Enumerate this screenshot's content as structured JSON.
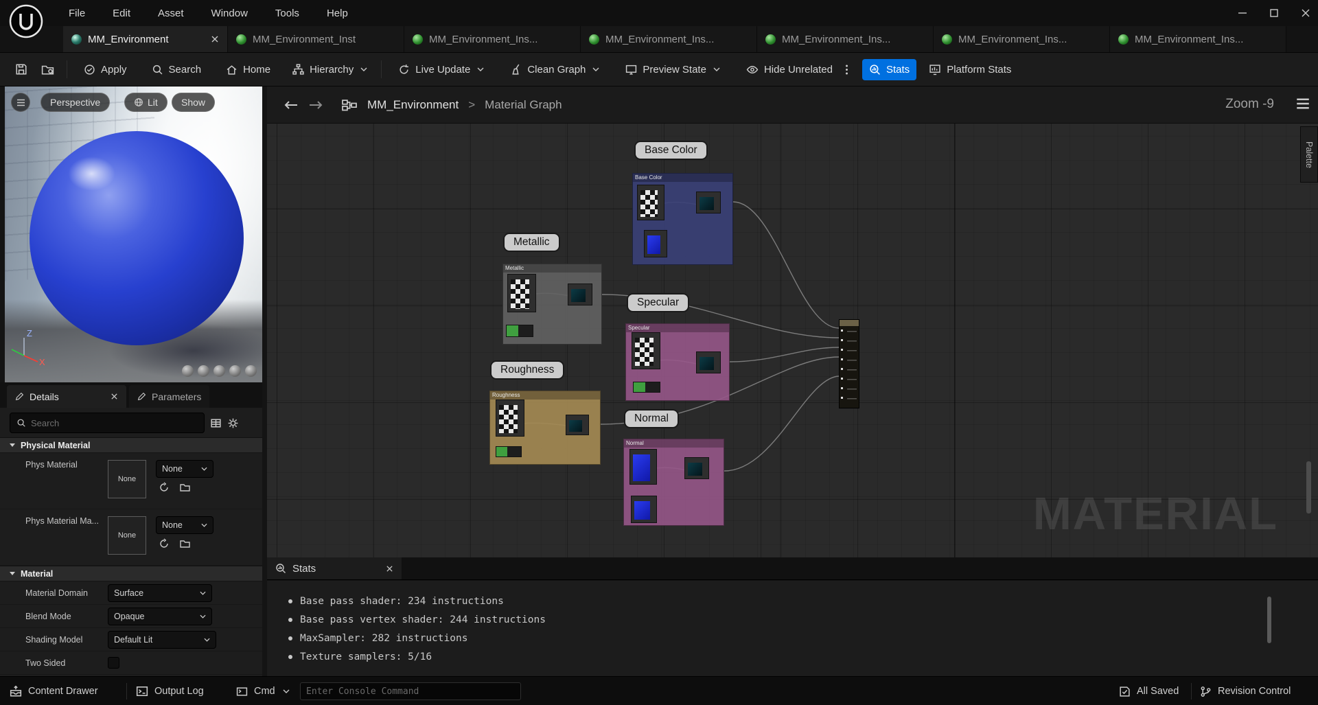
{
  "window": {
    "menu_items": [
      "File",
      "Edit",
      "Asset",
      "Window",
      "Tools",
      "Help"
    ]
  },
  "tab_bar": {
    "tabs": [
      {
        "label": "MM_Environment",
        "active": true
      },
      {
        "label": "MM_Environment_Inst",
        "active": false
      },
      {
        "label": "MM_Environment_Ins...",
        "active": false
      },
      {
        "label": "MM_Environment_Ins...",
        "active": false
      },
      {
        "label": "MM_Environment_Ins...",
        "active": false
      },
      {
        "label": "MM_Environment_Ins...",
        "active": false
      },
      {
        "label": "MM_Environment_Ins...",
        "active": false
      }
    ]
  },
  "toolbar": {
    "apply": "Apply",
    "search": "Search",
    "home": "Home",
    "hierarchy": "Hierarchy",
    "live_update": "Live Update",
    "clean_graph": "Clean Graph",
    "preview_state": "Preview State",
    "hide_unrelated": "Hide Unrelated",
    "stats": "Stats",
    "platform_stats": "Platform Stats",
    "stats_active_color": "#0070e0"
  },
  "viewport": {
    "perspective_label": "Perspective",
    "lit_label": "Lit",
    "show_label": "Show",
    "axis_z": "Z",
    "axis_x": "X",
    "sphere_color": "#2740cf"
  },
  "details_panel": {
    "tab_details": "Details",
    "tab_parameters": "Parameters",
    "search_placeholder": "Search",
    "sections": [
      {
        "title": "Physical Material",
        "rows": [
          {
            "label": "Phys Material",
            "thumb": "None",
            "value": "None"
          },
          {
            "label": "Phys Material Ma...",
            "thumb": "None",
            "value": "None"
          }
        ]
      },
      {
        "title": "Material",
        "rows": [
          {
            "label": "Material Domain",
            "value": "Surface"
          },
          {
            "label": "Blend Mode",
            "value": "Opaque"
          },
          {
            "label": "Shading Model",
            "value": "Default Lit"
          },
          {
            "label": "Two Sided",
            "value": "unchecked"
          }
        ]
      }
    ]
  },
  "graph": {
    "breadcrumb": {
      "root": "MM_Environment",
      "separator": ">",
      "current": "Material Graph"
    },
    "zoom_label": "Zoom -9",
    "palette_label": "Palette",
    "watermark": "MATERIAL",
    "groups": [
      {
        "label": "Base Color",
        "color": "#3a4076"
      },
      {
        "label": "Metallic",
        "color": "#626262"
      },
      {
        "label": "Specular",
        "color": "#965788"
      },
      {
        "label": "Roughness",
        "color": "#a38952"
      },
      {
        "label": "Normal",
        "color": "#965788"
      }
    ]
  },
  "stats_panel": {
    "title": "Stats",
    "lines": [
      "Base pass shader: 234 instructions",
      "Base pass vertex shader: 244 instructions",
      "MaxSampler: 282 instructions",
      "Texture samplers: 5/16"
    ]
  },
  "status_bar": {
    "content_drawer": "Content Drawer",
    "output_log": "Output Log",
    "cmd": "Cmd",
    "console_placeholder": "Enter Console Command",
    "all_saved": "All Saved",
    "revision_control": "Revision Control"
  }
}
